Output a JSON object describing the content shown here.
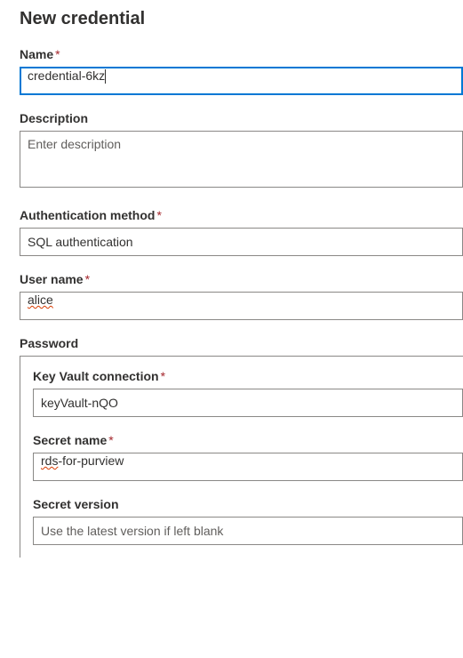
{
  "page": {
    "title": "New credential"
  },
  "required_marker": "*",
  "fields": {
    "name": {
      "label": "Name",
      "value": "credential-6kz",
      "required": true
    },
    "description": {
      "label": "Description",
      "placeholder": "Enter description",
      "value": "",
      "required": false
    },
    "auth_method": {
      "label": "Authentication method",
      "selected": "SQL authentication",
      "required": true
    },
    "user_name": {
      "label": "User name",
      "value": "alice",
      "spellcheck_flagged": "alice",
      "required": true
    },
    "password": {
      "label": "Password",
      "key_vault_connection": {
        "label": "Key Vault connection",
        "selected": "keyVault-nQO",
        "required": true
      },
      "secret_name": {
        "label": "Secret name",
        "value_prefix": "rds",
        "value_suffix": "-for-purview",
        "required": true
      },
      "secret_version": {
        "label": "Secret version",
        "placeholder": "Use the latest version if left blank",
        "value": "",
        "required": false
      }
    }
  }
}
